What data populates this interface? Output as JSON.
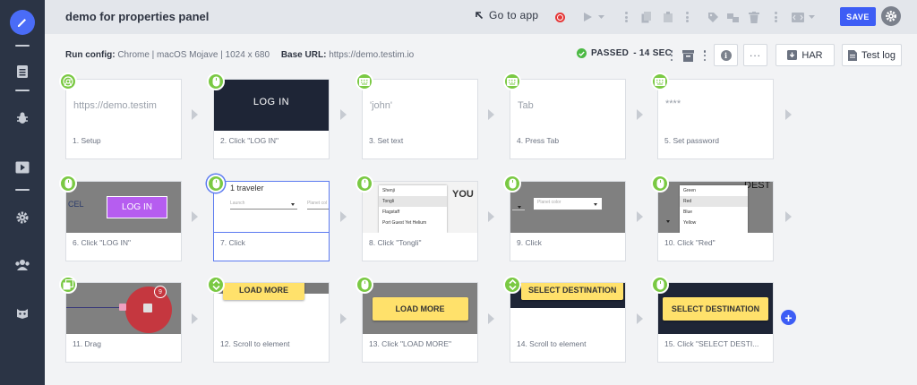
{
  "header": {
    "title": "demo for properties panel",
    "goto_label": "Go to app",
    "save_label": "SAVE"
  },
  "config": {
    "run_config_label": "Run config:",
    "run_config_value": "Chrome | macOS Mojave | 1024 x 680",
    "base_url_label": "Base URL:",
    "base_url_value": "https://demo.testim.io",
    "status": "PASSED",
    "duration": "- 14 SEC",
    "har_label": "HAR",
    "testlog_label": "Test log"
  },
  "colors": {
    "accent": "#3d5df5",
    "badge_green": "#7ac943",
    "sidebar": "#2b3445",
    "passed_green": "#4cb944"
  },
  "steps": [
    {
      "label": "1. Setup",
      "thumb_text": "https://demo.testim",
      "icon": "chrome-icon"
    },
    {
      "label": "2. Click \"LOG IN\"",
      "thumb_text": "LOG IN",
      "icon": "mouse-icon"
    },
    {
      "label": "3. Set text",
      "thumb_text": "'john'",
      "icon": "keyboard-icon"
    },
    {
      "label": "4. Press Tab",
      "thumb_text": "Tab",
      "icon": "keyboard-icon"
    },
    {
      "label": "5. Set password",
      "thumb_text": "****",
      "icon": "keyboard-icon"
    },
    {
      "label": "6. Click \"LOG IN\"",
      "thumb_text": "LOG IN",
      "thumb_side": "CEL",
      "icon": "mouse-icon"
    },
    {
      "label": "7. Click",
      "thumb_text": "1 traveler",
      "thumb_sub1": "Launch",
      "thumb_sub2": "Planet col",
      "icon": "mouse-icon"
    },
    {
      "label": "8. Click \"Tongli\"",
      "thumb_items": [
        "Shenji",
        "Tongli",
        "Flagstaff",
        "Port Guest Yet Helium"
      ],
      "thumb_side": "YOU",
      "icon": "mouse-icon"
    },
    {
      "label": "9. Click",
      "thumb_sub1": "Planet color",
      "icon": "mouse-icon"
    },
    {
      "label": "10. Click \"Red\"",
      "thumb_items": [
        "Green",
        "Red",
        "Blue",
        "Yellow"
      ],
      "thumb_side": "DEST",
      "icon": "mouse-icon"
    },
    {
      "label": "11. Drag",
      "thumb_text": "9",
      "icon": "drag-icon"
    },
    {
      "label": "12. Scroll to element",
      "thumb_text": "LOAD MORE",
      "icon": "scroll-icon"
    },
    {
      "label": "13. Click \"LOAD MORE\"",
      "thumb_text": "LOAD MORE",
      "icon": "mouse-icon"
    },
    {
      "label": "14. Scroll to element",
      "thumb_text": "SELECT DESTINATION",
      "icon": "scroll-icon"
    },
    {
      "label": "15. Click \"SELECT DESTI...",
      "thumb_text": "SELECT DESTINATION",
      "icon": "mouse-icon"
    }
  ]
}
